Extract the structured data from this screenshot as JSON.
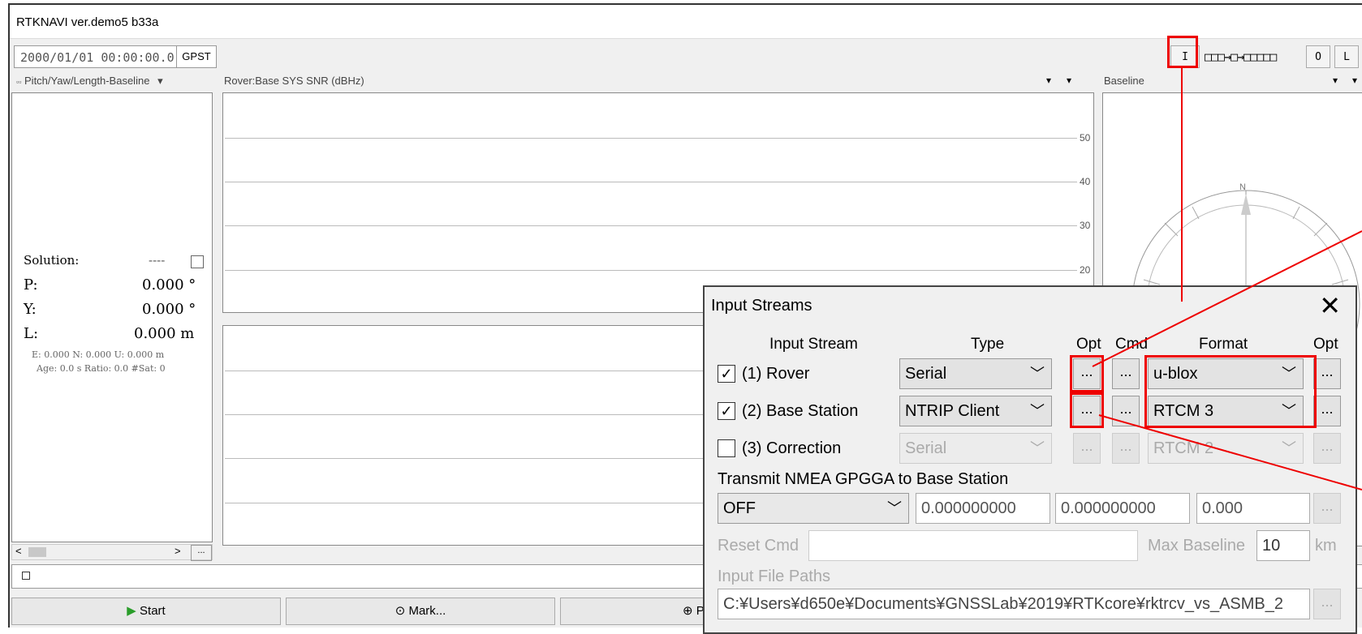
{
  "window": {
    "title": "RTKNAVI ver.demo5 b33a"
  },
  "time": {
    "value": "2000/01/01 00:00:00.0",
    "system": "GPST"
  },
  "stream_buttons": {
    "input": "I",
    "indicators": "□□□→□→□□□□□",
    "output": "O",
    "log": "L"
  },
  "panels": {
    "left_title": "Pitch/Yaw/Length-Baseline",
    "center_title": "Rover:Base SYS SNR (dBHz)",
    "right_title": "Baseline",
    "snr_ticks": [
      "50",
      "40",
      "30",
      "20"
    ],
    "compass_north": "N"
  },
  "solution": {
    "label": "Solution:",
    "status": "----",
    "p_label": "P:",
    "p_value": "0.000 °",
    "y_label": "Y:",
    "y_value": "0.000 °",
    "l_label": "L:",
    "l_value": "0.000 m",
    "enu": "E: 0.000 N: 0.000 U: 0.000 m",
    "age": "Age: 0.0 s Ratio: 0.0 #Sat: 0"
  },
  "scroll": {
    "left": "<",
    "right": ">",
    "more": "..."
  },
  "bottom": {
    "start": "Start",
    "mark": "Mark...",
    "plot": "Pl"
  },
  "dialog": {
    "title": "Input Streams",
    "close": "✕",
    "headers": {
      "stream": "Input Stream",
      "type": "Type",
      "opt": "Opt",
      "cmd": "Cmd",
      "format": "Format",
      "opt2": "Opt"
    },
    "rows": [
      {
        "label": "(1) Rover",
        "checked": "✓",
        "type": "Serial",
        "format": "u-blox"
      },
      {
        "label": "(2) Base Station",
        "checked": "✓",
        "type": "NTRIP Client",
        "format": "RTCM 3"
      },
      {
        "label": "(3) Correction",
        "checked": "",
        "type": "Serial",
        "format": "RTCM 2"
      }
    ],
    "dots": "...",
    "nmea_label": "Transmit NMEA GPGGA to Base Station",
    "nmea_mode": "OFF",
    "lat": "0.000000000",
    "lon": "0.000000000",
    "hgt": "0.000",
    "reset_cmd": "Reset Cmd",
    "max_baseline": "Max Baseline",
    "max_baseline_value": "10",
    "km": "km",
    "input_file_paths": "Input File Paths",
    "path": "C:¥Users¥d650e¥Documents¥GNSSLab¥2019¥RTKcore¥rktrcv_vs_ASMB_2"
  },
  "colors": {
    "highlight": "#e00000",
    "start_icon": "#2a9d2a"
  }
}
